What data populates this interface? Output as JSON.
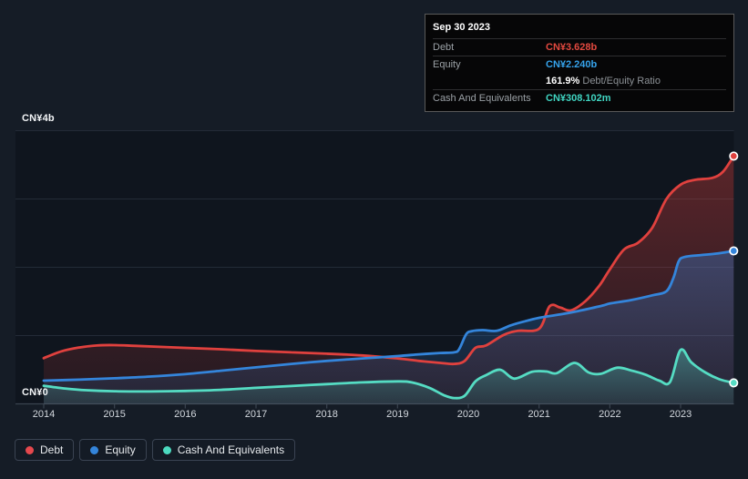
{
  "tooltip": {
    "date": "Sep 30 2023",
    "rows": [
      {
        "label": "Debt",
        "value": "CN¥3.628b",
        "color": "#e2493f"
      },
      {
        "label": "Equity",
        "value": "CN¥2.240b",
        "color": "#36a3ec"
      },
      {
        "label": "Cash And Equivalents",
        "value": "CN¥308.102m",
        "color": "#40d5c2"
      }
    ],
    "ratio": {
      "value": "161.9%",
      "label": "Debt/Equity Ratio"
    }
  },
  "legend": {
    "items": [
      {
        "label": "Debt",
        "color": "#e5484d"
      },
      {
        "label": "Equity",
        "color": "#3485db"
      },
      {
        "label": "Cash And Equivalents",
        "color": "#4cdabf"
      }
    ]
  },
  "chart_data": {
    "type": "area",
    "title": "",
    "xlabel": "",
    "ylabel": "",
    "x_ticks": [
      "2014",
      "2015",
      "2016",
      "2017",
      "2018",
      "2019",
      "2020",
      "2021",
      "2022",
      "2023"
    ],
    "x_end": 2023.75,
    "ylim": [
      0,
      4
    ],
    "y_gridline_values": [
      0,
      1,
      2,
      3,
      4
    ],
    "y_axis_top_label": "CN¥4b",
    "y_axis_zero_label": "CN¥0",
    "unit": "CN¥ billions",
    "legend_position": "bottom-left",
    "grid": true,
    "colors": {
      "page_bg": "#151c26",
      "plot_bg": "#0f151e",
      "gridline": "#232b37",
      "axis": "#3a434f",
      "marker_ring": "#ffffff"
    },
    "series": [
      {
        "name": "Debt",
        "color": "#e0413e",
        "points": [
          [
            2014.0,
            0.67
          ],
          [
            2014.25,
            0.77
          ],
          [
            2014.5,
            0.825
          ],
          [
            2014.75,
            0.855
          ],
          [
            2015.0,
            0.86
          ],
          [
            2015.3,
            0.85
          ],
          [
            2016.0,
            0.82
          ],
          [
            2016.5,
            0.8
          ],
          [
            2017.0,
            0.775
          ],
          [
            2017.5,
            0.755
          ],
          [
            2018.0,
            0.735
          ],
          [
            2018.5,
            0.71
          ],
          [
            2019.0,
            0.665
          ],
          [
            2019.3,
            0.63
          ],
          [
            2019.6,
            0.6
          ],
          [
            2019.8,
            0.585
          ],
          [
            2019.95,
            0.63
          ],
          [
            2020.1,
            0.82
          ],
          [
            2020.25,
            0.855
          ],
          [
            2020.5,
            1.01
          ],
          [
            2020.7,
            1.07
          ],
          [
            2021.0,
            1.1
          ],
          [
            2021.15,
            1.43
          ],
          [
            2021.3,
            1.41
          ],
          [
            2021.45,
            1.37
          ],
          [
            2021.65,
            1.5
          ],
          [
            2021.85,
            1.73
          ],
          [
            2022.0,
            1.97
          ],
          [
            2022.2,
            2.26
          ],
          [
            2022.4,
            2.36
          ],
          [
            2022.6,
            2.58
          ],
          [
            2022.8,
            3.0
          ],
          [
            2023.0,
            3.21
          ],
          [
            2023.2,
            3.28
          ],
          [
            2023.45,
            3.31
          ],
          [
            2023.6,
            3.4
          ],
          [
            2023.75,
            3.628
          ]
        ]
      },
      {
        "name": "Equity",
        "color": "#3485db",
        "points": [
          [
            2014.0,
            0.34
          ],
          [
            2014.5,
            0.355
          ],
          [
            2015.0,
            0.375
          ],
          [
            2015.5,
            0.4
          ],
          [
            2016.0,
            0.435
          ],
          [
            2016.5,
            0.485
          ],
          [
            2017.0,
            0.535
          ],
          [
            2017.5,
            0.585
          ],
          [
            2018.0,
            0.63
          ],
          [
            2018.5,
            0.665
          ],
          [
            2019.0,
            0.7
          ],
          [
            2019.3,
            0.725
          ],
          [
            2019.6,
            0.745
          ],
          [
            2019.8,
            0.755
          ],
          [
            2019.87,
            0.8
          ],
          [
            2019.97,
            1.02
          ],
          [
            2020.05,
            1.065
          ],
          [
            2020.2,
            1.08
          ],
          [
            2020.4,
            1.07
          ],
          [
            2020.6,
            1.15
          ],
          [
            2020.8,
            1.21
          ],
          [
            2021.0,
            1.26
          ],
          [
            2021.3,
            1.31
          ],
          [
            2021.6,
            1.37
          ],
          [
            2021.9,
            1.44
          ],
          [
            2022.0,
            1.47
          ],
          [
            2022.3,
            1.52
          ],
          [
            2022.6,
            1.59
          ],
          [
            2022.8,
            1.65
          ],
          [
            2022.9,
            1.85
          ],
          [
            2022.97,
            2.08
          ],
          [
            2023.05,
            2.15
          ],
          [
            2023.3,
            2.18
          ],
          [
            2023.5,
            2.2
          ],
          [
            2023.75,
            2.24
          ]
        ]
      },
      {
        "name": "Cash And Equivalents",
        "color": "#55dcc3",
        "points": [
          [
            2014.0,
            0.265
          ],
          [
            2014.3,
            0.225
          ],
          [
            2014.6,
            0.2
          ],
          [
            2015.0,
            0.185
          ],
          [
            2015.5,
            0.182
          ],
          [
            2016.0,
            0.19
          ],
          [
            2016.5,
            0.205
          ],
          [
            2017.0,
            0.235
          ],
          [
            2017.5,
            0.262
          ],
          [
            2018.0,
            0.29
          ],
          [
            2018.5,
            0.315
          ],
          [
            2019.0,
            0.33
          ],
          [
            2019.2,
            0.315
          ],
          [
            2019.45,
            0.235
          ],
          [
            2019.65,
            0.13
          ],
          [
            2019.8,
            0.085
          ],
          [
            2019.95,
            0.12
          ],
          [
            2020.1,
            0.33
          ],
          [
            2020.25,
            0.42
          ],
          [
            2020.45,
            0.5
          ],
          [
            2020.65,
            0.37
          ],
          [
            2020.9,
            0.47
          ],
          [
            2021.1,
            0.475
          ],
          [
            2021.25,
            0.45
          ],
          [
            2021.5,
            0.6
          ],
          [
            2021.7,
            0.46
          ],
          [
            2021.87,
            0.44
          ],
          [
            2022.1,
            0.53
          ],
          [
            2022.3,
            0.49
          ],
          [
            2022.5,
            0.43
          ],
          [
            2022.7,
            0.34
          ],
          [
            2022.85,
            0.32
          ],
          [
            2023.0,
            0.79
          ],
          [
            2023.15,
            0.61
          ],
          [
            2023.35,
            0.46
          ],
          [
            2023.55,
            0.36
          ],
          [
            2023.75,
            0.308
          ]
        ]
      }
    ]
  }
}
